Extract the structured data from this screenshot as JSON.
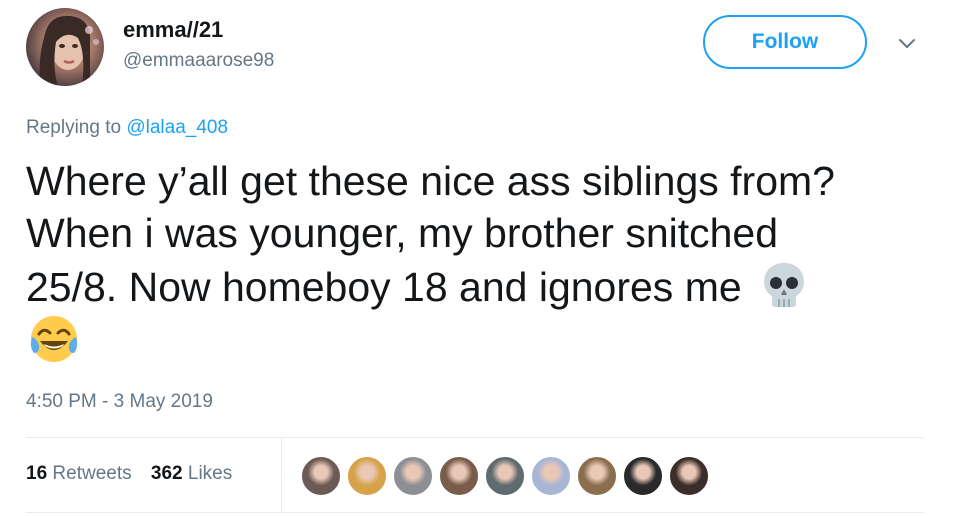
{
  "author": {
    "display_name": "emma//21",
    "handle": "@emmaaarose98",
    "avatar_icon": "profile-photo"
  },
  "actions": {
    "follow_label": "Follow",
    "menu_icon": "chevron-down-icon"
  },
  "reply": {
    "prefix": "Replying to ",
    "mention": "@lalaa_408"
  },
  "tweet": {
    "lines": [
      "Where y’all get these nice ass siblings from?",
      "When i was younger, my brother snitched",
      "25/8. Now homeboy 18 and ignores me"
    ],
    "emojis": [
      "skull-emoji",
      "face-with-tears-of-joy-emoji"
    ]
  },
  "timestamp": "4:50 PM - 3 May 2019",
  "stats": {
    "retweets_count": "16",
    "retweets_label": " Retweets",
    "likes_count": "362",
    "likes_label": " Likes"
  },
  "likers": [
    {
      "color": "#6b5a55"
    },
    {
      "color": "#d8a24a"
    },
    {
      "color": "#8c8f93"
    },
    {
      "color": "#7a5c4c"
    },
    {
      "color": "#5f6b6e"
    },
    {
      "color": "#a9b6d3"
    },
    {
      "color": "#8a6e4e"
    },
    {
      "color": "#2a2a2c"
    },
    {
      "color": "#3b2e2a"
    }
  ],
  "colors": {
    "accent": "#1da1f2",
    "secondary_text": "#657786",
    "primary_text": "#14171a",
    "divider": "#e6ecf0"
  }
}
